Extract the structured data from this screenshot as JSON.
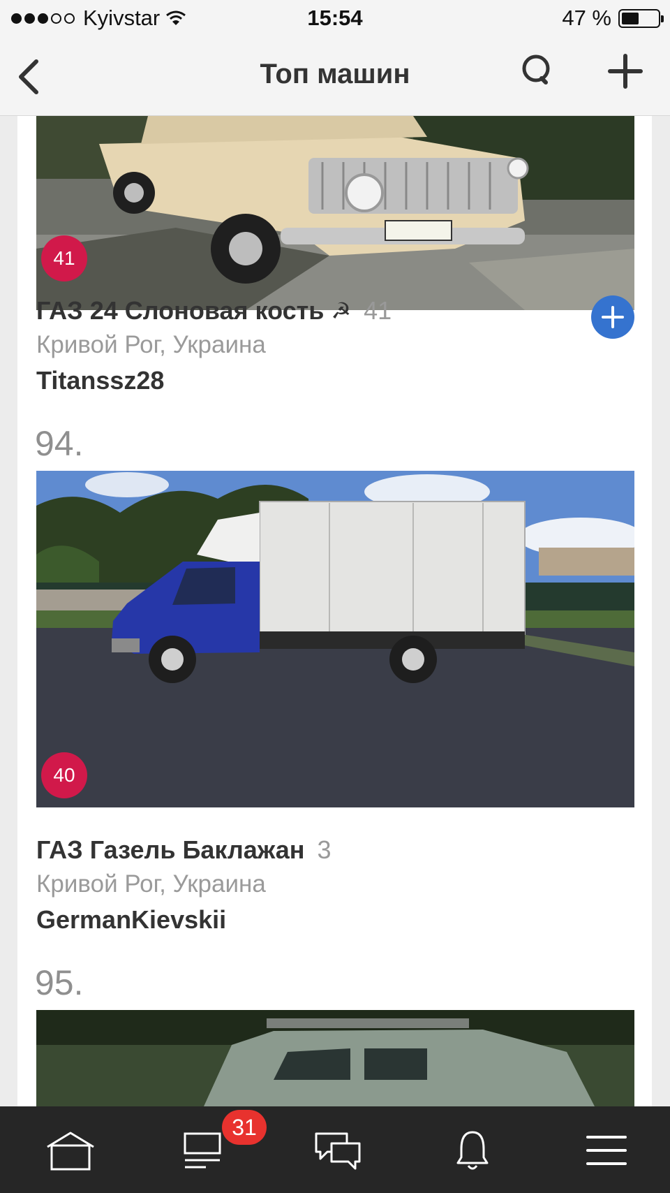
{
  "status_bar": {
    "carrier": "Kyivstar",
    "time": "15:54",
    "battery": "47 %",
    "battery_level": 0.47
  },
  "nav": {
    "title": "Топ машин",
    "back_icon": "chevron-left-icon",
    "search_icon": "search-icon",
    "add_icon": "plus-icon"
  },
  "feed": {
    "entries": [
      {
        "rank_label": "",
        "photo_rank": "41",
        "title": "ГАЗ 24 Слоновая кость",
        "title_emblem": "☭",
        "count": "41",
        "location": "Кривой Рог, Украина",
        "owner": "Titanssz28",
        "photo": "beige-gaz24-sedan"
      },
      {
        "rank_label": "94.",
        "photo_rank": "40",
        "title": "ГАЗ Газель Баклажан",
        "title_emblem": "",
        "count": "3",
        "location": "Кривой Рог, Украина",
        "owner": "GermanKievskii",
        "photo": "blue-gazelle-box-truck"
      },
      {
        "rank_label": "95.",
        "photo": "green-suv-partial"
      }
    ]
  },
  "tab_bar": {
    "items": [
      {
        "icon": "home-icon"
      },
      {
        "icon": "feed-icon",
        "badge": "31"
      },
      {
        "icon": "chat-icon"
      },
      {
        "icon": "bell-icon"
      },
      {
        "icon": "menu-icon"
      }
    ]
  },
  "colors": {
    "badge_red": "#d1194a",
    "follow_blue": "#3573cf",
    "tab_badge": "#e8322e",
    "tab_bar_bg": "#262626"
  }
}
